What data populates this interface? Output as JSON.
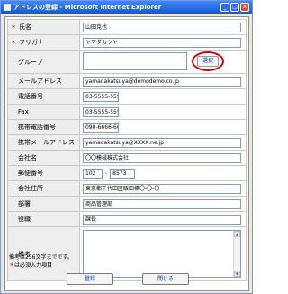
{
  "window": {
    "title": "アドレスの登録 - Microsoft Internet Explorer",
    "minimize": "_",
    "maximize": "□",
    "close": "×"
  },
  "required_mark": "＊",
  "form": {
    "name": {
      "label": "氏名",
      "value": "山田克也",
      "required": true
    },
    "furigana": {
      "label": "フリガナ",
      "value": "ヤマダカツヤ",
      "required": true
    },
    "group": {
      "label": "グループ",
      "value": "",
      "select_label": "選択"
    },
    "email": {
      "label": "メールアドレス",
      "value": "yamadakatsuya@demodemo.co.jp"
    },
    "phone": {
      "label": "電話番号",
      "value": "03-5555-5555"
    },
    "fax": {
      "label": "Fax",
      "value": "03-5555-5555"
    },
    "mobile_phone": {
      "label": "携帯電話番号",
      "value": "090-6666-6666"
    },
    "mobile_email": {
      "label": "携帯メールアドレス",
      "value": "yamadakatsuya@XXXX.ne.jp"
    },
    "company": {
      "label": "会社名",
      "value": "〇〇模械株式会社"
    },
    "zip": {
      "label": "郵便番号",
      "value1": "102",
      "separator": "-",
      "value2": "8573"
    },
    "address": {
      "label": "会社住所",
      "value": "東京都千代田区飯田橋〇-〇-〇"
    },
    "department": {
      "label": "部署",
      "value": "商品管理部"
    },
    "position": {
      "label": "役職",
      "value": "課長"
    },
    "memo": {
      "label": "備考",
      "value": ""
    }
  },
  "notes": {
    "memo_limit": "備考は256文字までです。",
    "required_note": "は必須入力項目"
  },
  "buttons": {
    "register": "登録",
    "close": "閉じる"
  }
}
